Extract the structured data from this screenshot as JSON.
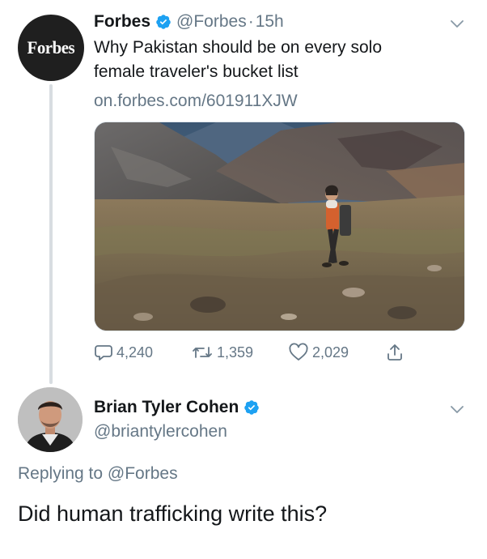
{
  "tweet": {
    "avatar_text": "Forbes",
    "name": "Forbes",
    "handle": "@Forbes",
    "separator": "·",
    "time": "15h",
    "text_line1": "Why Pakistan should be on every solo",
    "text_line2": "female traveler's bucket list",
    "link": "on.forbes.com/601911XJW",
    "stats": {
      "replies": "4,240",
      "retweets": "1,359",
      "likes": "2,029"
    },
    "icons": {
      "verified": "verified-badge-icon",
      "menu": "chevron-down-icon",
      "reply": "comment-icon",
      "retweet": "retweet-icon",
      "like": "heart-icon",
      "share": "share-icon"
    }
  },
  "reply": {
    "name": "Brian Tyler Cohen",
    "handle": "@briantylercohen",
    "replying_prefix": "Replying to",
    "replying_mention": "@Forbes",
    "text": "Did human trafficking write this?"
  },
  "colors": {
    "verified": "#1da1f2",
    "text": "#14171a",
    "muted": "#657786",
    "thread_line": "#d8dde1"
  }
}
